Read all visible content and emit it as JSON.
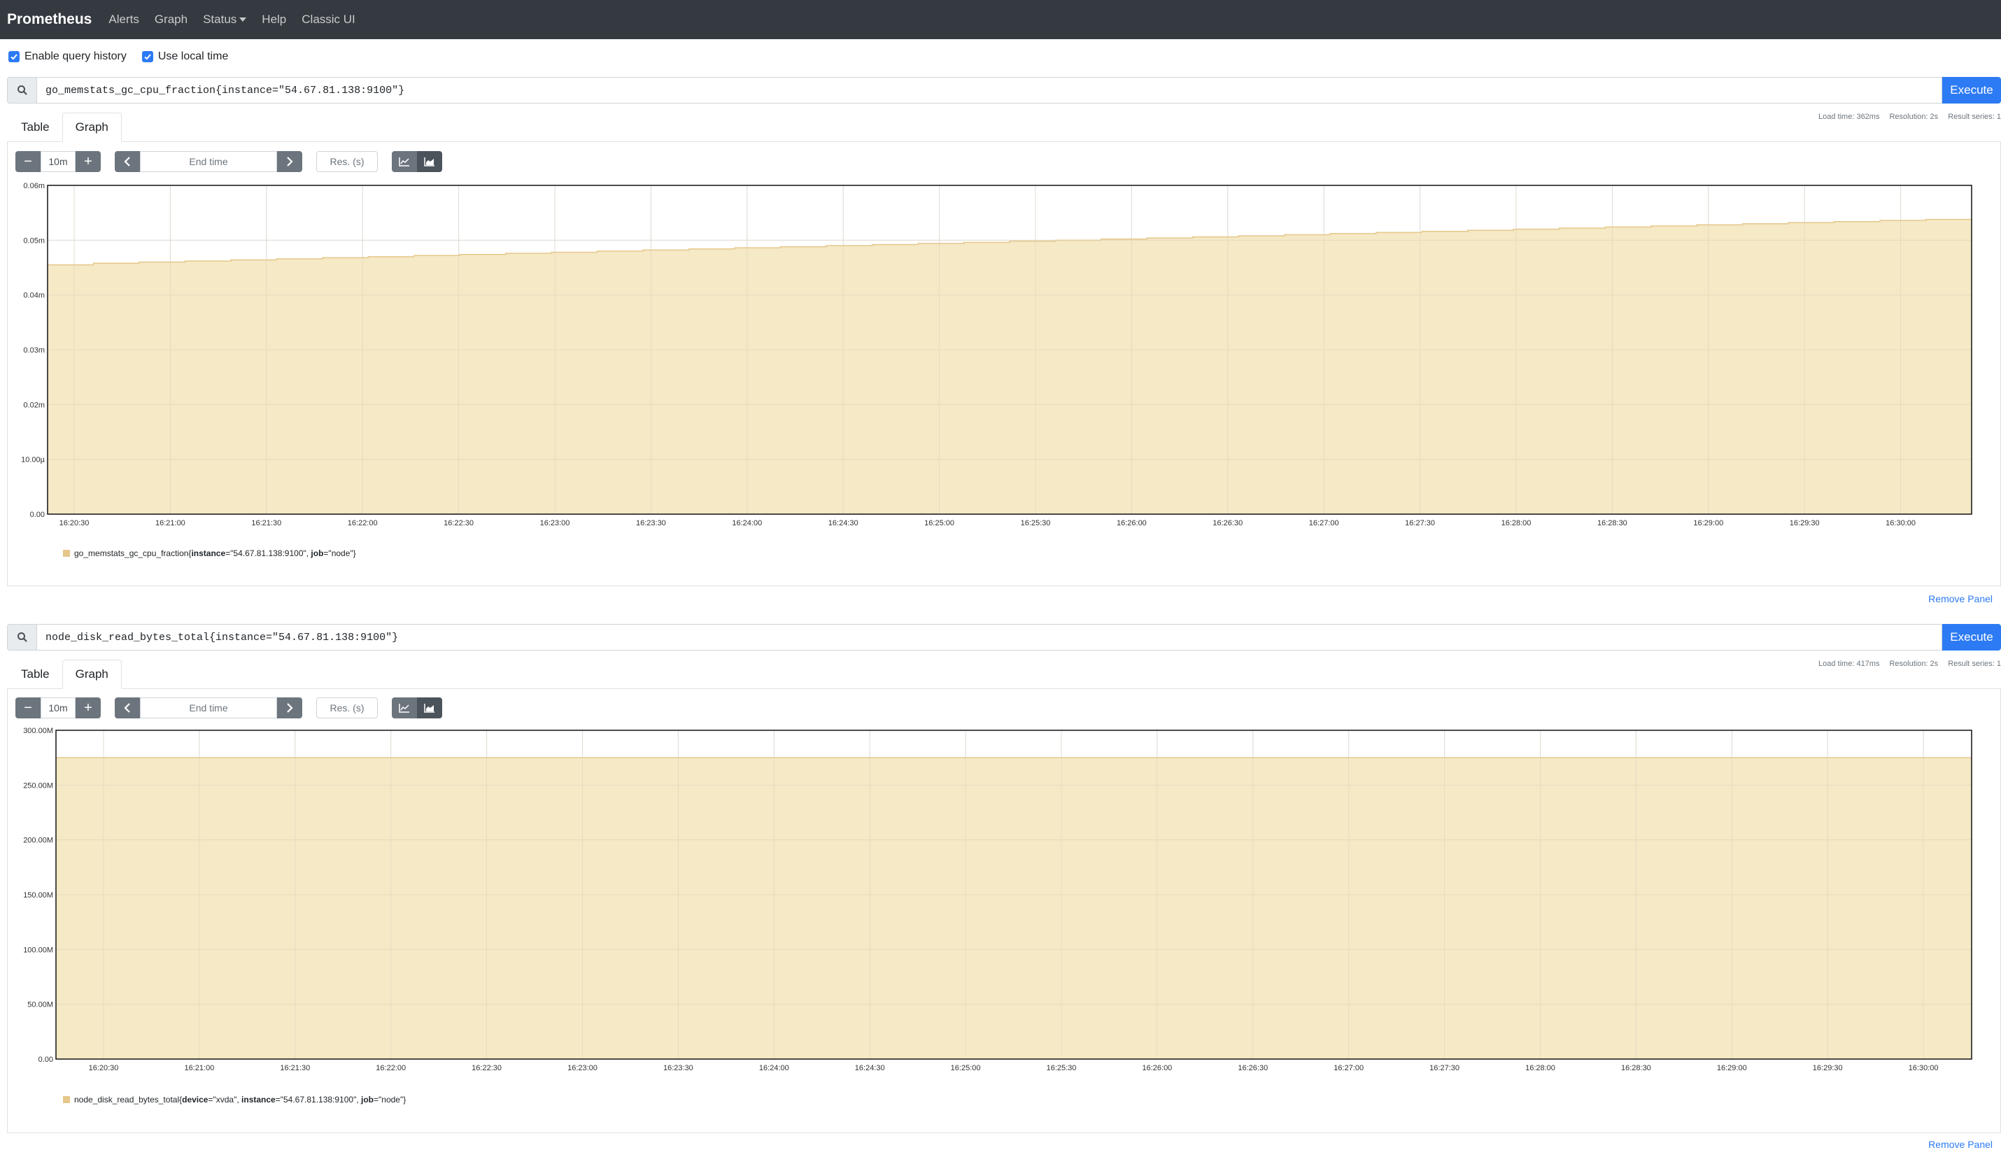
{
  "navbar": {
    "brand": "Prometheus",
    "links": [
      "Alerts",
      "Graph",
      "Status",
      "Help",
      "Classic UI"
    ]
  },
  "options": {
    "query_history": {
      "label": "Enable query history",
      "checked": true
    },
    "local_time": {
      "label": "Use local time",
      "checked": true
    }
  },
  "colors": {
    "accent": "#2d7bf4",
    "area_fill": "#f3e5bc",
    "area_line": "#e5c78a",
    "navbar": "#343a40"
  },
  "panels": [
    {
      "query": "go_memstats_gc_cpu_fraction{instance=\"54.67.81.138:9100\"}",
      "execute_label": "Execute",
      "stats": {
        "load_time": "Load time: 362ms",
        "resolution": "Resolution: 2s",
        "result_series": "Result series: 1"
      },
      "tabs": [
        "Table",
        "Graph"
      ],
      "active_tab": "Graph",
      "range": "10m",
      "end_time_placeholder": "End time",
      "res_placeholder": "Res. (s)",
      "legend": {
        "metric": "go_memstats_gc_cpu_fraction",
        "labels": [
          [
            "instance",
            "\"54.67.81.138:9100\""
          ],
          [
            "job",
            "\"node\""
          ]
        ]
      },
      "remove_label": "Remove Panel"
    },
    {
      "query": "node_disk_read_bytes_total{instance=\"54.67.81.138:9100\"}",
      "execute_label": "Execute",
      "stats": {
        "load_time": "Load time: 417ms",
        "resolution": "Resolution: 2s",
        "result_series": "Result series: 1"
      },
      "tabs": [
        "Table",
        "Graph"
      ],
      "active_tab": "Graph",
      "range": "10m",
      "end_time_placeholder": "End time",
      "res_placeholder": "Res. (s)",
      "legend": {
        "metric": "node_disk_read_bytes_total",
        "labels": [
          [
            "device",
            "\"xvda\""
          ],
          [
            "instance",
            "\"54.67.81.138:9100\""
          ],
          [
            "job",
            "\"node\""
          ]
        ]
      },
      "remove_label": "Remove Panel"
    }
  ],
  "chart_data": [
    {
      "type": "area",
      "x_ticks": [
        "16:20:30",
        "16:21:00",
        "16:21:30",
        "16:22:00",
        "16:22:30",
        "16:23:00",
        "16:23:30",
        "16:24:00",
        "16:24:30",
        "16:25:00",
        "16:25:30",
        "16:26:00",
        "16:26:30",
        "16:27:00",
        "16:27:30",
        "16:28:00",
        "16:28:30",
        "16:29:00",
        "16:29:30",
        "16:30:00"
      ],
      "y_ticks": [
        "0.00",
        "10.00µ",
        "0.02m",
        "0.03m",
        "0.04m",
        "0.05m",
        "0.06m"
      ],
      "ylim": [
        0,
        6e-05
      ],
      "x_range_seconds": [
        0,
        600
      ],
      "x_start": "16:20:17",
      "series": [
        {
          "name": "go_memstats_gc_cpu_fraction{instance=\"54.67.81.138:9100\", job=\"node\"}",
          "step_values": [
            4.55e-05,
            4.58e-05,
            4.6e-05,
            4.62e-05,
            4.64e-05,
            4.66e-05,
            4.68e-05,
            4.7e-05,
            4.72e-05,
            4.74e-05,
            4.76e-05,
            4.78e-05,
            4.8e-05,
            4.82e-05,
            4.84e-05,
            4.86e-05,
            4.88e-05,
            4.9e-05,
            4.92e-05,
            4.94e-05,
            4.96e-05,
            4.98e-05,
            5e-05,
            5.02e-05,
            5.04e-05,
            5.06e-05,
            5.08e-05,
            5.1e-05,
            5.12e-05,
            5.14e-05,
            5.16e-05,
            5.18e-05,
            5.2e-05,
            5.22e-05,
            5.24e-05,
            5.26e-05,
            5.28e-05,
            5.3e-05,
            5.32e-05,
            5.34e-05,
            5.36e-05,
            5.38e-05
          ]
        }
      ],
      "grid": true
    },
    {
      "type": "area",
      "x_ticks": [
        "16:20:30",
        "16:21:00",
        "16:21:30",
        "16:22:00",
        "16:22:30",
        "16:23:00",
        "16:23:30",
        "16:24:00",
        "16:24:30",
        "16:25:00",
        "16:25:30",
        "16:26:00",
        "16:26:30",
        "16:27:00",
        "16:27:30",
        "16:28:00",
        "16:28:30",
        "16:29:00",
        "16:29:30",
        "16:30:00"
      ],
      "y_ticks": [
        "0.00",
        "50.00M",
        "100.00M",
        "150.00M",
        "200.00M",
        "250.00M",
        "300.00M"
      ],
      "ylim": [
        0,
        300000000
      ],
      "x_range_seconds": [
        0,
        600
      ],
      "x_start": "16:20:17",
      "series": [
        {
          "name": "node_disk_read_bytes_total{device=\"xvda\", instance=\"54.67.81.138:9100\", job=\"node\"}",
          "step_values": [
            275000000
          ]
        }
      ],
      "grid": true
    }
  ]
}
